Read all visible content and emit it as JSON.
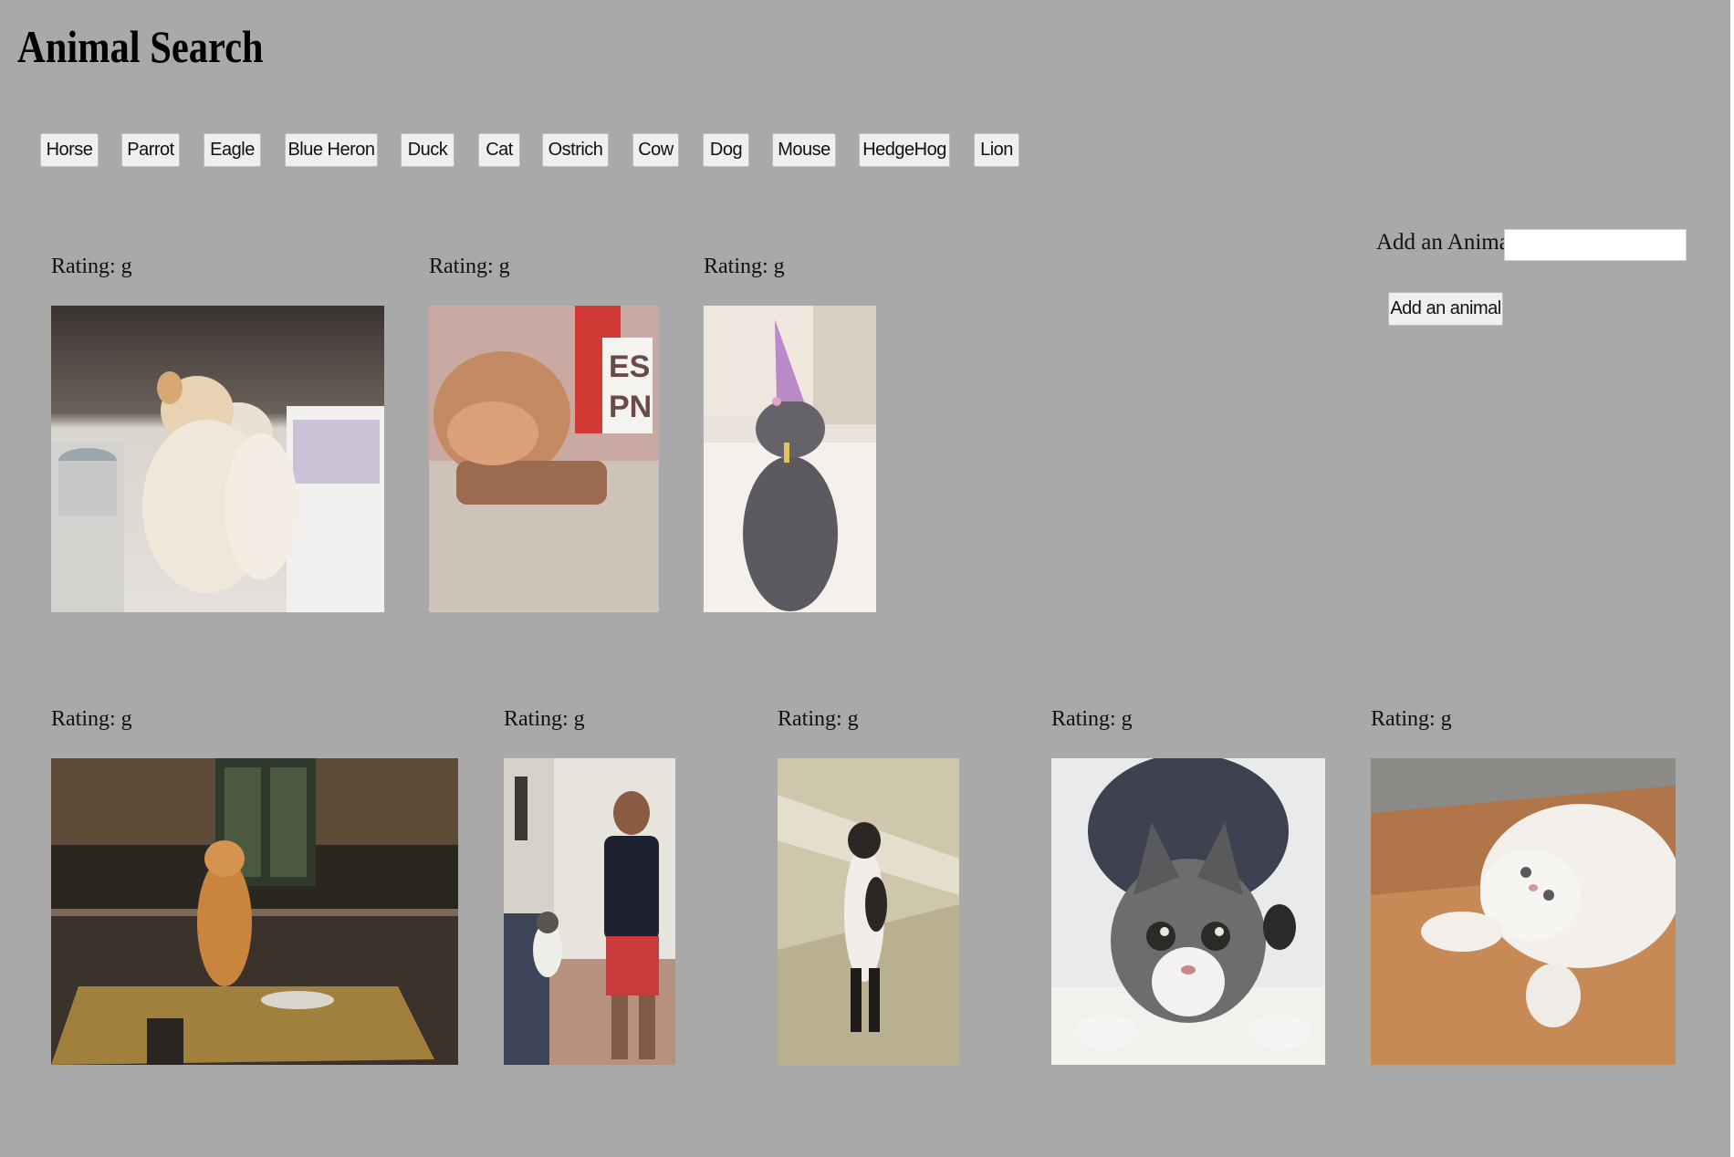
{
  "title": "Animal Search",
  "animal_buttons": [
    "Horse",
    "Parrot",
    "Eagle",
    "Blue Heron",
    "Duck",
    "Cat",
    "Ostrich",
    "Cow",
    "Dog",
    "Mouse",
    "HedgeHog",
    "Lion"
  ],
  "add_form": {
    "label": "Add an Animal",
    "input_value": "",
    "input_placeholder": "",
    "submit_label": "Add an animal"
  },
  "results": [
    {
      "rating": "Rating: g",
      "scene": "kittens-hugging"
    },
    {
      "rating": "Rating: g",
      "scene": "cat-blur-espn"
    },
    {
      "rating": "Rating: g",
      "scene": "cat-party-hat"
    },
    {
      "rating": "Rating: g",
      "scene": "cat-kitchen-table"
    },
    {
      "rating": "Rating: g",
      "scene": "man-and-cat"
    },
    {
      "rating": "Rating: g",
      "scene": "cat-standing"
    },
    {
      "rating": "Rating: g",
      "scene": "cat-crouching"
    },
    {
      "rating": "Rating: g",
      "scene": "white-kitten"
    }
  ],
  "colors": {
    "page_background": "#a9a9a9",
    "button_background": "#efefef",
    "input_background": "#ffffff"
  }
}
